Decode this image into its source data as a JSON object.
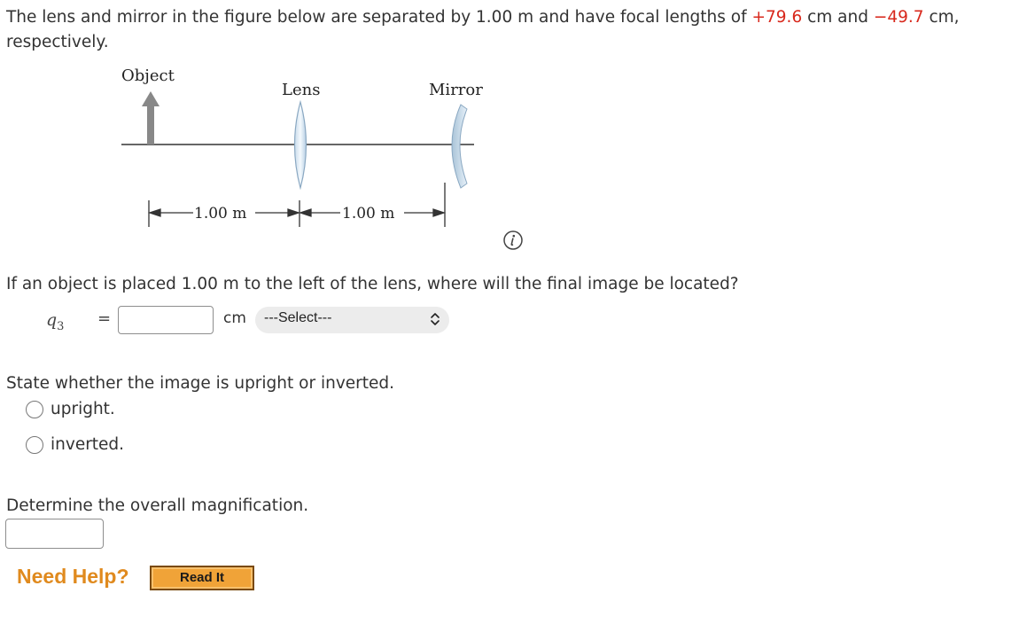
{
  "intro": {
    "text1": "The lens and mirror in the figure below are separated by 1.00 m and have focal lengths of ",
    "lens_focal": "+79.6",
    "text2": " cm and ",
    "mirror_focal": "−49.7",
    "text3": " cm, respectively."
  },
  "figure": {
    "object_label": "Object",
    "lens_label": "Lens",
    "mirror_label": "Mirror",
    "distance1": "1.00 m",
    "distance2": "1.00 m"
  },
  "question1": {
    "text": "If an object is placed 1.00 m to the left of the lens, where will the final image be located?",
    "var_symbol": "q",
    "var_sub": "3",
    "equals": "=",
    "input_value": "",
    "unit": "cm",
    "select_value": "---Select---"
  },
  "question2": {
    "text": "State whether the image is upright or inverted.",
    "options": [
      "upright.",
      "inverted."
    ]
  },
  "question3": {
    "text": "Determine the overall magnification.",
    "input_value": ""
  },
  "help": {
    "label": "Need Help?",
    "button": "Read It"
  },
  "icons": {
    "info": "info-icon",
    "select_chevron": "chevron-updown-icon"
  },
  "colors": {
    "highlight": "#d8281c",
    "help": "#e08a1e",
    "read_it_button": "#f0a338"
  }
}
